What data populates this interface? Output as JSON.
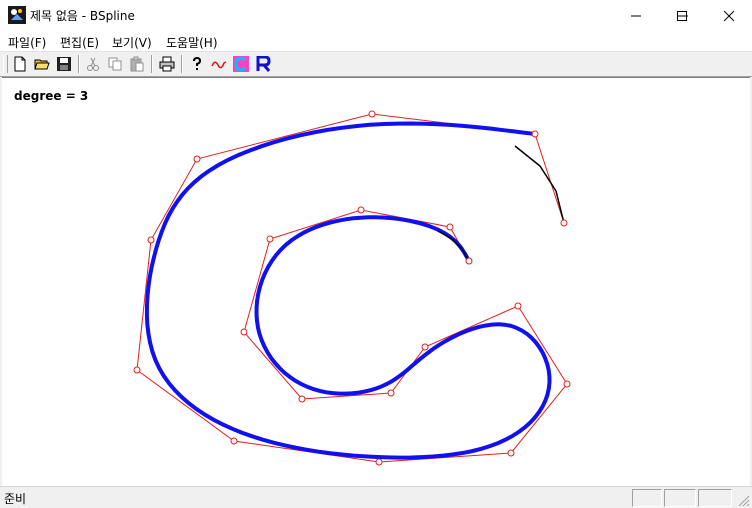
{
  "window": {
    "title": "제목 없음 - BSpline"
  },
  "menu": {
    "file": "파일(F)",
    "edit": "편집(E)",
    "view": "보기(V)",
    "help": "도움말(H)"
  },
  "canvas": {
    "degree_text": "degree = 3"
  },
  "status": {
    "ready": "준비"
  },
  "colors": {
    "control_polygon": "#e0201c",
    "bspline": "#1010f0",
    "bezier": "#000000"
  },
  "curves": {
    "outer_control_points": [
      [
        535,
        133
      ],
      [
        372,
        113
      ],
      [
        197,
        158
      ],
      [
        151,
        239
      ],
      [
        137,
        369
      ],
      [
        234,
        440
      ],
      [
        379,
        461
      ],
      [
        511,
        452
      ],
      [
        567,
        383
      ],
      [
        518,
        305
      ],
      [
        425,
        346
      ],
      [
        391,
        392
      ],
      [
        302,
        398
      ],
      [
        244,
        331
      ],
      [
        270,
        238
      ],
      [
        361,
        209
      ],
      [
        450,
        226
      ],
      [
        469,
        260
      ]
    ],
    "inner_control_points": [
      [
        469,
        260
      ],
      [
        450,
        226
      ],
      [
        361,
        209
      ],
      [
        270,
        238
      ],
      [
        244,
        331
      ],
      [
        302,
        398
      ],
      [
        391,
        392
      ],
      [
        425,
        346
      ],
      [
        518,
        305
      ],
      [
        567,
        383
      ],
      [
        511,
        452
      ],
      [
        379,
        461
      ],
      [
        234,
        440
      ],
      [
        137,
        369
      ],
      [
        151,
        239
      ],
      [
        197,
        158
      ],
      [
        372,
        113
      ],
      [
        535,
        133
      ],
      [
        564,
        222
      ]
    ],
    "black_tail_outer": [
      [
        515,
        145
      ],
      [
        540,
        165
      ],
      [
        556,
        190
      ],
      [
        564,
        222
      ]
    ],
    "black_tail_inner": [
      [
        438,
        230
      ],
      [
        452,
        238
      ],
      [
        462,
        248
      ],
      [
        469,
        260
      ]
    ]
  }
}
